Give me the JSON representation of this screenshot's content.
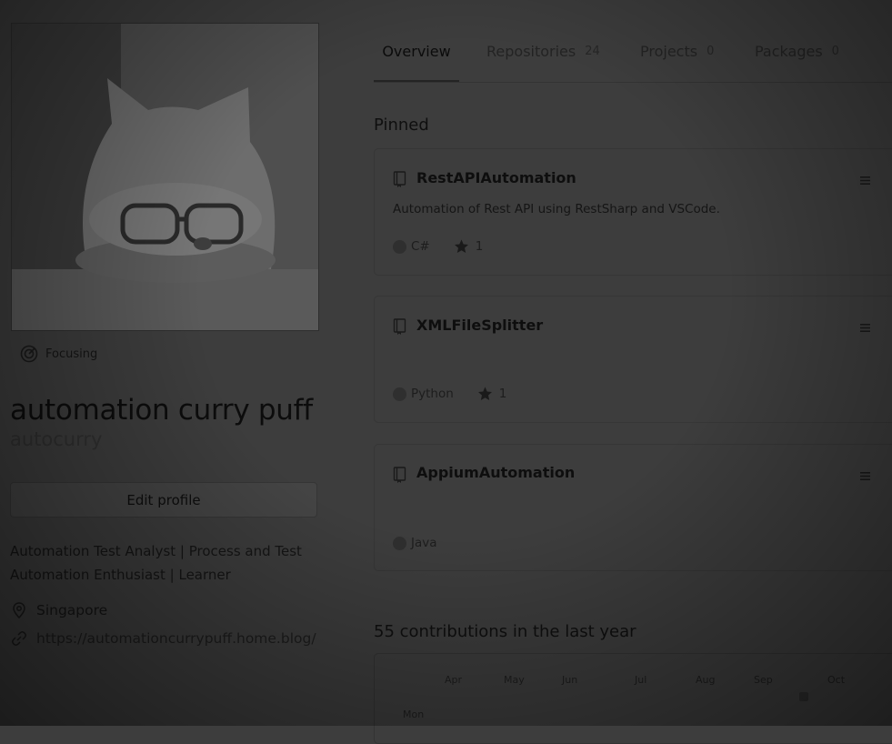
{
  "profile": {
    "status": "Focusing",
    "full_name": "automation curry puff",
    "username": "autocurry",
    "edit_button": "Edit profile",
    "bio": "Automation Test Analyst | Process and Test Automation Enthusiast | Learner",
    "location": "Singapore",
    "website": "https://automationcurrypuff.home.blog/"
  },
  "tabs": [
    {
      "label": "Overview",
      "count": ""
    },
    {
      "label": "Repositories",
      "count": "24"
    },
    {
      "label": "Projects",
      "count": "0"
    },
    {
      "label": "Packages",
      "count": "0"
    }
  ],
  "pinned": {
    "title": "Pinned",
    "repos": [
      {
        "name": "RestAPIAutomation",
        "description": "Automation of Rest API using RestSharp and VSCode.",
        "language": "C#",
        "stars": "1"
      },
      {
        "name": "XMLFileSplitter",
        "description": "",
        "language": "Python",
        "stars": "1"
      },
      {
        "name": "AppiumAutomation",
        "description": "",
        "language": "Java",
        "stars": ""
      }
    ]
  },
  "contributions": {
    "title": "55 contributions in the last year",
    "months": [
      "Apr",
      "May",
      "Jun",
      "Jul",
      "Aug",
      "Sep",
      "Oct"
    ],
    "weekday": "Mon"
  },
  "icons": {
    "status": "focus-target-icon",
    "location": "map-pin-icon",
    "website": "link-icon",
    "repo": "repo-book-icon",
    "drag": "drag-handle-icon",
    "star": "star-icon"
  }
}
